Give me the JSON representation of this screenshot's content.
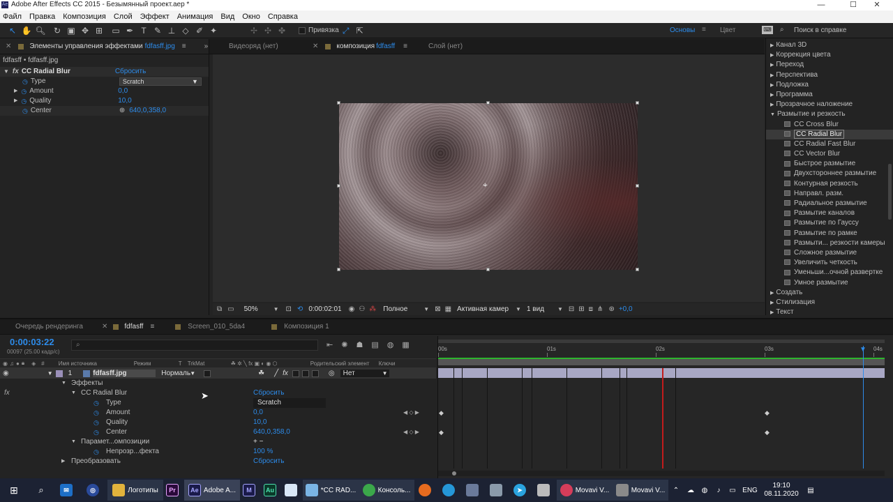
{
  "window": {
    "title": "Adobe After Effects CC 2015 - Безымянный проект.aep *",
    "min": "—",
    "max": "☐",
    "close": "✕"
  },
  "menu": [
    "Файл",
    "Правка",
    "Композиция",
    "Слой",
    "Эффект",
    "Анимация",
    "Вид",
    "Окно",
    "Справка"
  ],
  "toolbar": {
    "snap_label": "Привязка",
    "workspace": "Основы",
    "color": "Цвет",
    "search_placeholder": "Поиск в справке"
  },
  "effect_controls": {
    "tab": "Элементы управления эффектами",
    "tab_file": "fdfasff.jpg",
    "breadcrumb": "fdfasff • fdfasff.jpg",
    "effect_name": "CC Radial Blur",
    "reset": "Сбросить",
    "props": [
      {
        "name": "Type",
        "value": "Scratch"
      },
      {
        "name": "Amount",
        "value": "0,0"
      },
      {
        "name": "Quality",
        "value": "10,0"
      },
      {
        "name": "Center",
        "value": "640,0,358,0"
      }
    ]
  },
  "viewer": {
    "tabs": [
      {
        "label": "Видеоряд (нет)"
      },
      {
        "label": "композиция",
        "file": "fdfasff"
      },
      {
        "label": "Слой (нет)"
      }
    ],
    "comp_chip": "fdfasff",
    "zoom": "50%",
    "timecode": "0:00:02:01",
    "resolution": "Полное",
    "camera": "Активная камер",
    "views": "1 вид",
    "exposure": "+0,0"
  },
  "effects_browser": {
    "items": [
      {
        "label": "Канал 3D",
        "indent": 0,
        "arrow": "▶"
      },
      {
        "label": "Коррекция цвета",
        "indent": 0,
        "arrow": "▶"
      },
      {
        "label": "Переход",
        "indent": 0,
        "arrow": "▶"
      },
      {
        "label": "Перспектива",
        "indent": 0,
        "arrow": "▶"
      },
      {
        "label": "Подложка",
        "indent": 0,
        "arrow": "▶"
      },
      {
        "label": "Программа",
        "indent": 0,
        "arrow": "▶"
      },
      {
        "label": "Прозрачное наложение",
        "indent": 0,
        "arrow": "▶"
      },
      {
        "label": "Размытие и резкость",
        "indent": 0,
        "arrow": "▼"
      },
      {
        "label": "CC Cross Blur",
        "indent": 1,
        "arrow": ""
      },
      {
        "label": "CC Radial Blur",
        "indent": 1,
        "arrow": "",
        "selected": true
      },
      {
        "label": "CC Radial Fast Blur",
        "indent": 1,
        "arrow": ""
      },
      {
        "label": "CC Vector Blur",
        "indent": 1,
        "arrow": ""
      },
      {
        "label": "Быстрое размытие",
        "indent": 1,
        "arrow": ""
      },
      {
        "label": "Двухстороннее размытие",
        "indent": 1,
        "arrow": ""
      },
      {
        "label": "Контурная резкость",
        "indent": 1,
        "arrow": ""
      },
      {
        "label": "Направл. разм.",
        "indent": 1,
        "arrow": ""
      },
      {
        "label": "Радиальное размытие",
        "indent": 1,
        "arrow": ""
      },
      {
        "label": "Размытие каналов",
        "indent": 1,
        "arrow": ""
      },
      {
        "label": "Размытие по Гауссу",
        "indent": 1,
        "arrow": ""
      },
      {
        "label": "Размытие по рамке",
        "indent": 1,
        "arrow": ""
      },
      {
        "label": "Размыти... резкости камеры",
        "indent": 1,
        "arrow": ""
      },
      {
        "label": "Сложное размытие",
        "indent": 1,
        "arrow": ""
      },
      {
        "label": "Увеличить четкость",
        "indent": 1,
        "arrow": ""
      },
      {
        "label": "Уменьши...очной развертке",
        "indent": 1,
        "arrow": ""
      },
      {
        "label": "Умное размытие",
        "indent": 1,
        "arrow": ""
      },
      {
        "label": "Создать",
        "indent": 0,
        "arrow": "▶"
      },
      {
        "label": "Стилизация",
        "indent": 0,
        "arrow": "▶"
      },
      {
        "label": "Текст",
        "indent": 0,
        "arrow": "▶"
      }
    ]
  },
  "timeline": {
    "tabs": [
      {
        "label": "Очередь рендеринга"
      },
      {
        "label": "fdfasff"
      },
      {
        "label": "Screen_010_5da4"
      },
      {
        "label": "Композиция 1"
      }
    ],
    "timecode": "0:00:03:22",
    "fps": "00097 (25.00 кадр/с)",
    "columns": {
      "source": "Имя источника",
      "mode": "Режим",
      "t": "T",
      "trkmat": "TrkMat",
      "parent": "Родительский элемент",
      "keys": "Ключи"
    },
    "layer": {
      "num": "1",
      "name": "fdfasff.jpg",
      "mode": "Нормаль",
      "parent": "Нет"
    },
    "ruler": [
      "00s",
      "01s",
      "02s",
      "03s",
      "04s"
    ],
    "rows": [
      {
        "label": "Эффекты",
        "indent": 1,
        "value": ""
      },
      {
        "label": "CC Radial Blur",
        "indent": 2,
        "value": "Сбросить"
      },
      {
        "label": "Type",
        "indent": 3,
        "value": "Scratch"
      },
      {
        "label": "Amount",
        "indent": 3,
        "value": "0,0"
      },
      {
        "label": "Quality",
        "indent": 3,
        "value": "10,0"
      },
      {
        "label": "Center",
        "indent": 3,
        "value": "640,0,358,0"
      },
      {
        "label": "Парамет...омпозиции",
        "indent": 2,
        "value": "+ −"
      },
      {
        "label": "Непрозр...фекта",
        "indent": 3,
        "value": "100 %"
      },
      {
        "label": "Преобразовать",
        "indent": 1,
        "value": "Сбросить"
      }
    ]
  },
  "taskbar": {
    "apps": [
      {
        "label": "Логотипы"
      },
      {
        "label": "Adobe A..."
      },
      {
        "label": "*CC RAD..."
      },
      {
        "label": "Консоль..."
      },
      {
        "label": "Movavi V..."
      },
      {
        "label": "Movavi V..."
      }
    ],
    "lang": "ENG",
    "time": "19:10",
    "date": "08.11.2020"
  }
}
